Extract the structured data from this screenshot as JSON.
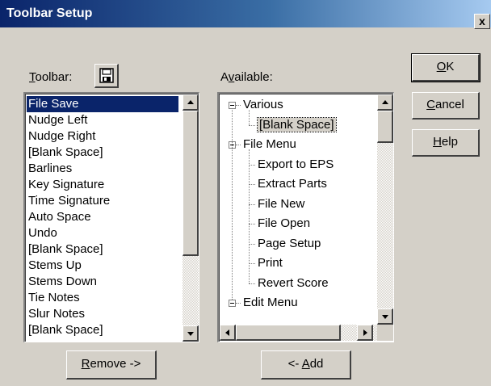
{
  "window": {
    "title": "Toolbar Setup",
    "close_label": "x"
  },
  "toolbar_label": {
    "prefix": "",
    "accel": "T",
    "rest": "oolbar:"
  },
  "available_label": {
    "prefix": "A",
    "accel": "v",
    "rest": "ailable:"
  },
  "toolbar_icon": "floppy-disk-icon",
  "toolbar_items": [
    "File Save",
    "Nudge Left",
    "Nudge Right",
    "[Blank Space]",
    "Barlines",
    "Key Signature",
    "Time Signature",
    "Auto Space",
    "Undo",
    "[Blank Space]",
    "Stems Up",
    "Stems Down",
    "Tie Notes",
    "Slur Notes",
    "[Blank Space]"
  ],
  "selected_toolbar_item": "File Save",
  "available_tree": [
    {
      "label": "Various",
      "level": 0,
      "group": true
    },
    {
      "label": "[Blank Space]",
      "level": 1,
      "group": false
    },
    {
      "label": "File Menu",
      "level": 0,
      "group": true
    },
    {
      "label": "Export to EPS",
      "level": 1,
      "group": false
    },
    {
      "label": "Extract Parts",
      "level": 1,
      "group": false
    },
    {
      "label": "File New",
      "level": 1,
      "group": false
    },
    {
      "label": "File Open",
      "level": 1,
      "group": false
    },
    {
      "label": "Page Setup",
      "level": 1,
      "group": false
    },
    {
      "label": "Print",
      "level": 1,
      "group": false
    },
    {
      "label": "Revert Score",
      "level": 1,
      "group": false
    },
    {
      "label": "Edit Menu",
      "level": 0,
      "group": true
    }
  ],
  "buttons": {
    "ok": {
      "accel": "O",
      "rest": "K"
    },
    "cancel": {
      "accel": "C",
      "rest": "ancel"
    },
    "help": {
      "accel": "H",
      "rest": "elp"
    },
    "remove": {
      "accel": "R",
      "rest": "emove ->"
    },
    "add": {
      "prefix": "<- ",
      "accel": "A",
      "rest": "dd"
    }
  },
  "colors": {
    "face": "#d4d0c8",
    "selection": "#0a246a",
    "title_start": "#0a246a"
  }
}
